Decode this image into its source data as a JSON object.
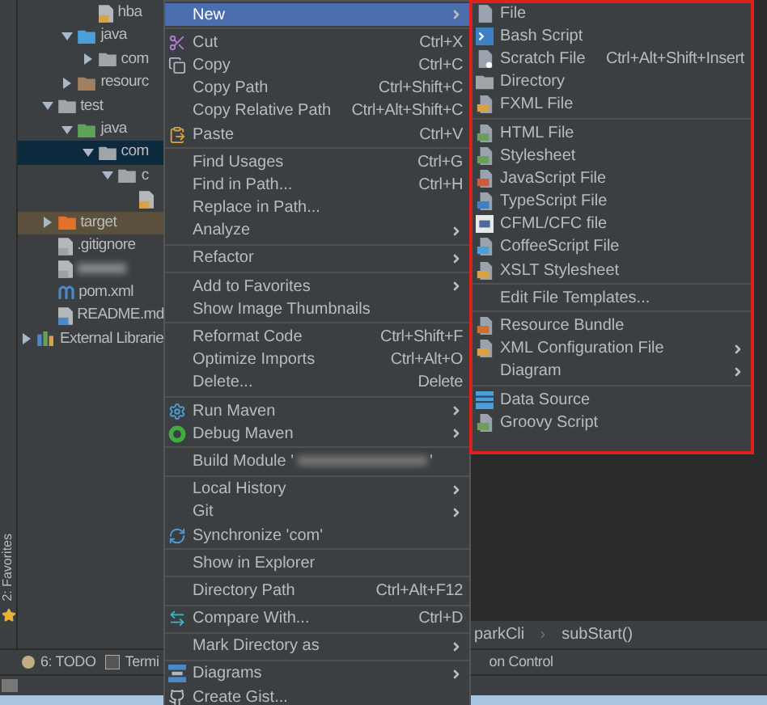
{
  "tree": [
    {
      "children": [
        {
          "children": [
            {
              "children": [
                {
                  "label": "hba",
                  "kind": "class"
                }
              ]
            },
            {
              "label": "java",
              "kind": "source-folder",
              "expanded": true,
              "children": [
                {
                  "label": "com",
                  "kind": "package",
                  "expanded": false
                }
              ]
            },
            {
              "label": "resourc",
              "kind": "resource-folder",
              "expanded": false
            }
          ]
        },
        {
          "label": "test",
          "kind": "folder",
          "expanded": true,
          "children": [
            {
              "label": "java",
              "kind": "test-folder",
              "expanded": true,
              "children": [
                {
                  "label": "com",
                  "kind": "package",
                  "expanded": true,
                  "selected": true,
                  "children": [
                    {
                      "label": "c",
                      "kind": "package",
                      "expanded": true,
                      "children": [
                        {
                          "kind": "class"
                        }
                      ]
                    }
                  ]
                }
              ]
            }
          ]
        },
        {
          "label": "target",
          "kind": "excluded-folder",
          "expanded": false,
          "excluded": true
        },
        {
          "label": ".gitignore",
          "kind": "file"
        },
        {
          "kind": "blurred-file"
        },
        {
          "label": "pom.xml",
          "kind": "maven"
        },
        {
          "label": "README.md",
          "kind": "markdown"
        }
      ]
    },
    {
      "label": "External Librarie",
      "kind": "library",
      "expanded": false
    }
  ],
  "context_menu": [
    [
      {
        "label": "New",
        "highlighted": true,
        "submenu": true
      }
    ],
    [
      {
        "label": "Cut",
        "kind": "cut",
        "shortcut": "Ctrl+X"
      },
      {
        "label": "Copy",
        "kind": "copy",
        "shortcut": "Ctrl+C"
      },
      {
        "label": "Copy Path",
        "shortcut": "Ctrl+Shift+C"
      },
      {
        "label": "Copy Relative Path",
        "shortcut": "Ctrl+Alt+Shift+C"
      },
      {
        "label": "Paste",
        "kind": "paste",
        "shortcut": "Ctrl+V"
      }
    ],
    [
      {
        "label": "Find Usages",
        "shortcut": "Ctrl+G"
      },
      {
        "label": "Find in Path...",
        "shortcut": "Ctrl+H"
      },
      {
        "label": "Replace in Path..."
      },
      {
        "label": "Analyze",
        "submenu": true
      }
    ],
    [
      {
        "label": "Refactor",
        "submenu": true
      }
    ],
    [
      {
        "label": "Add to Favorites",
        "submenu": true
      },
      {
        "label": "Show Image Thumbnails"
      }
    ],
    [
      {
        "label": "Reformat Code",
        "shortcut": "Ctrl+Shift+F"
      },
      {
        "label": "Optimize Imports",
        "shortcut": "Ctrl+Alt+O"
      },
      {
        "label": "Delete...",
        "shortcut": "Delete"
      }
    ],
    [
      {
        "label": "Run Maven",
        "kind": "gear",
        "submenu": true
      },
      {
        "label": "Debug Maven",
        "kind": "debug",
        "submenu": true
      }
    ],
    [
      {
        "label": "Build Module '",
        "redacted": true,
        "suffix": "'"
      }
    ],
    [
      {
        "label": "Local History",
        "submenu": true
      },
      {
        "label": "Git",
        "submenu": true
      },
      {
        "label": "Synchronize 'com'",
        "kind": "sync"
      }
    ],
    [
      {
        "label": "Show in Explorer"
      }
    ],
    [
      {
        "label": "Directory Path",
        "shortcut": "Ctrl+Alt+F12"
      }
    ],
    [
      {
        "label": "Compare With...",
        "kind": "compare",
        "shortcut": "Ctrl+D"
      }
    ],
    [
      {
        "label": "Mark Directory as",
        "submenu": true
      }
    ],
    [
      {
        "label": "Diagrams",
        "kind": "diagram",
        "submenu": true
      },
      {
        "label": "Create Gist...",
        "kind": "gist"
      }
    ]
  ],
  "new_submenu": [
    [
      {
        "label": "File",
        "kind": "file"
      },
      {
        "label": "Bash Script",
        "kind": "bash"
      },
      {
        "label": "Scratch File",
        "kind": "scratch",
        "shortcut": "Ctrl+Alt+Shift+Insert"
      },
      {
        "label": "Directory",
        "kind": "folder"
      },
      {
        "label": "FXML File",
        "kind": "xml"
      }
    ],
    [
      {
        "label": "HTML File",
        "kind": "html"
      },
      {
        "label": "Stylesheet",
        "kind": "css"
      },
      {
        "label": "JavaScript File",
        "kind": "js"
      },
      {
        "label": "TypeScript File",
        "kind": "ts"
      },
      {
        "label": "CFML/CFC file",
        "kind": "cf"
      },
      {
        "label": "CoffeeScript File",
        "kind": "coffee"
      },
      {
        "label": "XSLT Stylesheet",
        "kind": "xml"
      }
    ],
    [
      {
        "label": "Edit File Templates..."
      }
    ],
    [
      {
        "label": "Resource Bundle",
        "kind": "bundle"
      },
      {
        "label": "XML Configuration File",
        "kind": "xml",
        "submenu": true
      },
      {
        "label": "Diagram",
        "submenu": true
      }
    ],
    [
      {
        "label": "Data Source",
        "kind": "db"
      },
      {
        "label": "Groovy Script",
        "kind": "groovy"
      }
    ]
  ],
  "side_tab": "2: Favorites",
  "breadcrumbs": [
    "parkCli",
    "subStart()"
  ],
  "tool_tabs": [
    {
      "label": "6: TODO",
      "kind": "todo"
    },
    {
      "label": "Termi",
      "kind": "terminal"
    },
    {
      "label": "on Control"
    }
  ]
}
